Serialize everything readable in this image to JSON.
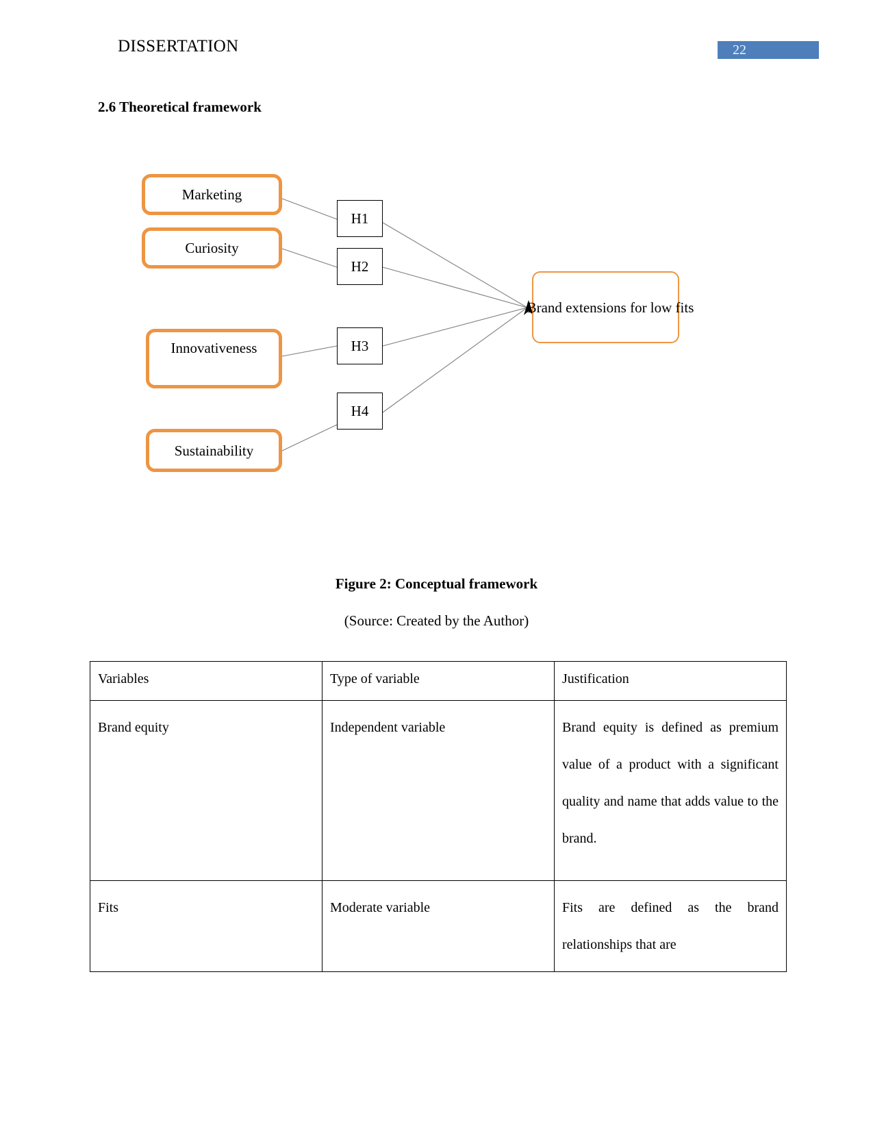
{
  "header": {
    "document_title": "DISSERTATION",
    "page_number": "22",
    "badge_color": "#4e7fbb"
  },
  "section": {
    "heading": "2.6 Theoretical framework"
  },
  "figure": {
    "caption": "Figure 2: Conceptual framework",
    "source": "(Source: Created by the Author)",
    "accent_color": "#ed9543",
    "nodes": [
      {
        "label": "Marketing"
      },
      {
        "label": "Curiosity"
      },
      {
        "label": "Innovativeness"
      },
      {
        "label": "Sustainability"
      }
    ],
    "hypotheses": [
      {
        "label": "H1"
      },
      {
        "label": "H2"
      },
      {
        "label": "H3"
      },
      {
        "label": "H4"
      }
    ],
    "target": {
      "label": "Brand extensions for low fits"
    }
  },
  "table": {
    "headers": [
      "Variables",
      "Type of variable",
      "Justification"
    ],
    "rows": [
      {
        "variable": "Brand equity",
        "type": "Independent variable",
        "justification": "Brand equity is defined as premium value of a product with a significant quality and name that adds value to the brand."
      },
      {
        "variable": "Fits",
        "type": "Moderate variable",
        "justification": "Fits are defined as the brand relationships that are"
      }
    ]
  }
}
